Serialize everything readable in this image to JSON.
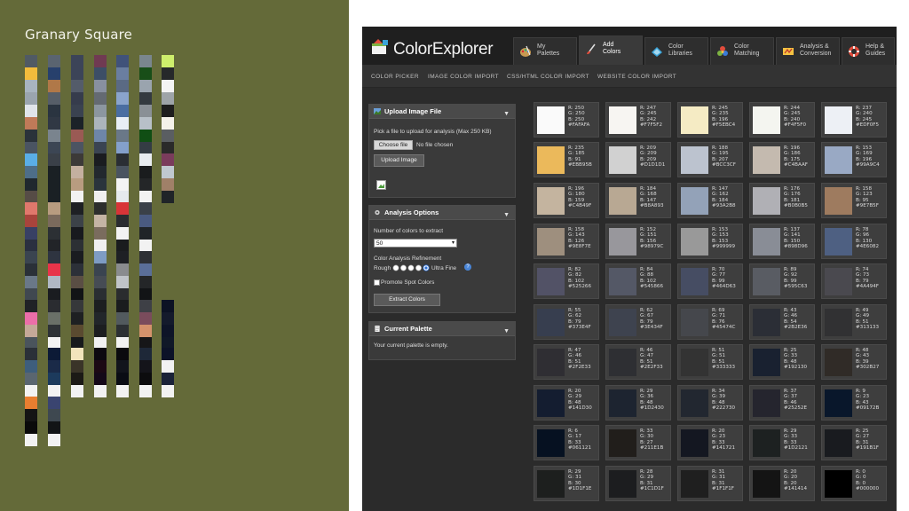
{
  "left": {
    "title": "Granary Square",
    "palettes": [
      {
        "colors": [
          "#505a64",
          "#f2bc3c",
          "#a8b4c0",
          "#9aa4ae"
        ]
      },
      {
        "colors": [
          "#5a6470",
          "#27406c",
          "#b07848",
          "#565e68"
        ]
      },
      {
        "colors": [
          "#3c4458",
          "#3c4458",
          "#545c6a",
          "#363c4c"
        ]
      },
      {
        "colors": [
          "#703a52",
          "#3c4e66",
          "#8890a0",
          "#646a72"
        ]
      },
      {
        "colors": [
          "#40527a",
          "#6a7ea0",
          "#5a6a84",
          "#8aa4cc"
        ]
      },
      {
        "colors": [
          "#7a868e",
          "#184e18",
          "#9aa4ae",
          "#343a40"
        ]
      },
      {
        "colors": [
          "#ceee6c",
          "#26282a",
          "#f4f4f4",
          "#9ea4a8"
        ]
      },
      {
        "colors": [
          "#e0e4ea",
          "#c07a58",
          "#2a323a",
          "#4a5462"
        ]
      },
      {
        "colors": [
          "#2a3440",
          "#303844",
          "#7a848e",
          "#3c4654"
        ]
      },
      {
        "colors": [
          "#3a4250",
          "#1c2228",
          "#9a5a54",
          "#4c5462"
        ]
      },
      {
        "colors": [
          "#8c96a0",
          "#acb4bc",
          "#6e86a8",
          "#3a4452"
        ]
      },
      {
        "colors": [
          "#4a6ea2",
          "#e8eef6",
          "#6a7888",
          "#84a0cc"
        ]
      },
      {
        "colors": [
          "#8a9096",
          "#b8c0c8",
          "#104e14",
          "#343c44"
        ]
      },
      {
        "colors": [
          "#1e1e1e",
          "#f4f2ea",
          "#5a5e62",
          "#2a2a2a"
        ]
      },
      {
        "colors": [
          "#5aaee6",
          "#4e6e88",
          "#20282e",
          "#564c46"
        ]
      },
      {
        "colors": [
          "#3a4048",
          "#1a2024",
          "#1a2024",
          "#1a2024"
        ]
      },
      {
        "colors": [
          "#3c3a38",
          "#c4b0a0",
          "#b89c80",
          "#f2f2f2"
        ]
      },
      {
        "colors": [
          "#1a1c20",
          "#22282e",
          "#2a343c",
          "#f0f0f0"
        ]
      },
      {
        "colors": [
          "#2a2e34",
          "#4a5460",
          "#f4f4f4",
          "#e6eaee"
        ]
      },
      {
        "colors": [
          "#e8ecf0",
          "#1a1c1e",
          "#242628",
          "#f2f2f2"
        ]
      },
      {
        "colors": [
          "#7a3c5c",
          "#c0c8d0",
          "#a08068",
          "#202428"
        ]
      },
      {
        "colors": [
          "#e0786c",
          "#a8443c",
          "#384064",
          "#2a3040"
        ]
      },
      {
        "colors": [
          "#b89c80",
          "#7a6a5c",
          "#2c3034",
          "#222428"
        ]
      },
      {
        "colors": [
          "#1e2024",
          "#3c4248",
          "#181a1e",
          "#2c3034"
        ]
      },
      {
        "colors": [
          "#2c2e2c",
          "#c4b4a4",
          "#7a6c5e",
          "#f0f0f0"
        ]
      },
      {
        "colors": [
          "#d83438",
          "#2a2c30",
          "#f2f2f2",
          "#1a1c1e"
        ]
      },
      {
        "colors": [
          "#3a4048",
          "#4a5a80",
          "#202428",
          "#f2f2f2"
        ]
      },
      {
        "colors": [
          "#3a4450",
          "#2a3038",
          "#6a7888",
          "#404850"
        ]
      },
      {
        "colors": [
          "#2e3440",
          "#e8344a",
          "#b0b8c4",
          "#1a1c20"
        ]
      },
      {
        "colors": [
          "#1a1c20",
          "#2c3038",
          "#5a4e44",
          "#121416"
        ]
      },
      {
        "colors": [
          "#7e9cc4",
          "#3a4450",
          "#464c54",
          "#2a2e32"
        ]
      },
      {
        "colors": [
          "#1e2024",
          "#8a8c8e",
          "#c0c4c8",
          "#2a2c2e"
        ]
      },
      {
        "colors": [
          "#2e3034",
          "#5a6e98",
          "#242628",
          "#121416"
        ]
      },
      {
        "colors": [
          "#202226",
          "#ec6ea8",
          "#c4a898",
          "#4a545c"
        ]
      },
      {
        "colors": [
          "#2a2c30",
          "#6a7068",
          "#2e3236",
          "#f2f2f2"
        ]
      },
      {
        "colors": [
          "#36383a",
          "#1e2022",
          "#5a4a30",
          "#181a1c"
        ]
      },
      {
        "colors": [
          "#1c1e20",
          "#22262a",
          "#1c1e20",
          "#f2f2f2"
        ]
      },
      {
        "colors": [
          "#1a1c1e",
          "#525a5e",
          "#2c3034",
          "#f2f2f2"
        ]
      },
      {
        "colors": [
          "#3e4046",
          "#7a4c5c",
          "#d4926c",
          "#161618"
        ]
      },
      {
        "colors": [
          "#0c1224",
          "#141a2c",
          "#0e1428",
          "#101828"
        ]
      },
      {
        "colors": [
          "#2a3038",
          "#3e5e7c",
          "#5a6670",
          "#f2f2f2"
        ]
      },
      {
        "colors": [
          "#0c1a36",
          "#1a2a48",
          "#1c3a5c",
          "#f2f2f2"
        ]
      },
      {
        "colors": [
          "#f2e4bc",
          "#3a3428",
          "#1c1a16",
          "#f2f2f2"
        ]
      },
      {
        "colors": [
          "#0c0810",
          "#1c0814",
          "#140818",
          "#f2f2f2"
        ]
      },
      {
        "colors": [
          "#0a0a0e",
          "#12141c",
          "#0a0c14",
          "#f2f2f2"
        ]
      },
      {
        "colors": [
          "#1e2838",
          "#14141a",
          "#0c0c0e",
          "#f2f2f2"
        ]
      },
      {
        "colors": [
          "#0c1228",
          "#f2f2f2",
          "#1a2238",
          "#f2f2f2"
        ]
      },
      {
        "colors": [
          "#e87e30",
          "#141414",
          "#0a0a0a",
          "#f2f2f2"
        ]
      },
      {
        "colors": [
          "#3a4470",
          "#3e4850",
          "#121416",
          "#f2f2f2"
        ]
      }
    ]
  },
  "app": {
    "title_part1": "Color",
    "title_part2": "Explorer",
    "tabs": [
      {
        "line1": "My",
        "line2": "Palettes",
        "icon": "palette-icon"
      },
      {
        "line1": "Add",
        "line2": "Colors",
        "icon": "brush-icon"
      },
      {
        "line1": "Color",
        "line2": "Libraries",
        "icon": "library-icon"
      },
      {
        "line1": "Color",
        "line2": "Matching",
        "icon": "color-wheel-icon"
      },
      {
        "line1": "Analysis &",
        "line2": "Conversion",
        "icon": "analysis-icon"
      },
      {
        "line1": "Help &",
        "line2": "Guides",
        "icon": "lifebuoy-icon"
      }
    ],
    "active_tab": "Add Colors",
    "subnav": [
      "COLOR PICKER",
      "IMAGE COLOR IMPORT",
      "CSS/HTML COLOR IMPORT",
      "WEBSITE COLOR IMPORT"
    ],
    "upload": {
      "title": "Upload Image File",
      "description": "Pick a file to upload for analysis (Max 250 KB)",
      "choose_file": "Choose file",
      "no_file": "No file chosen",
      "upload_button": "Upload Image"
    },
    "options": {
      "title": "Analysis Options",
      "num_label": "Number of colors to extract",
      "num_value": "50",
      "refine_label": "Color Analysis Refinement",
      "rough": "Rough",
      "fine": "Ultra Fine",
      "help": "?",
      "promote": "Promote Spot Colors",
      "extract_button": "Extract Colors"
    },
    "current": {
      "title": "Current Palette",
      "empty": "Your current palette is empty."
    },
    "swatches": [
      {
        "r": "R: 250",
        "g": "G: 250",
        "b": "B: 250",
        "hex": "#FAFAFA",
        "color": "#FAFAFA"
      },
      {
        "r": "R: 247",
        "g": "G: 245",
        "b": "B: 242",
        "hex": "#F7F5F2",
        "color": "#F7F5F2"
      },
      {
        "r": "R: 245",
        "g": "G: 235",
        "b": "B: 196",
        "hex": "#F5EBC4",
        "color": "#F5EBC4"
      },
      {
        "r": "R: 244",
        "g": "G: 245",
        "b": "B: 240",
        "hex": "#F4F5F0",
        "color": "#F4F5F0"
      },
      {
        "r": "R: 237",
        "g": "G: 240",
        "b": "B: 245",
        "hex": "#EDF0F5",
        "color": "#EDF0F5"
      },
      {
        "r": "R: 235",
        "g": "G: 185",
        "b": "B: 91",
        "hex": "#EBB95B",
        "color": "#EBB95B"
      },
      {
        "r": "R: 209",
        "g": "G: 209",
        "b": "B: 209",
        "hex": "#D1D1D1",
        "color": "#D1D1D1"
      },
      {
        "r": "R: 188",
        "g": "G: 195",
        "b": "B: 207",
        "hex": "#BCC3CF",
        "color": "#BCC3CF"
      },
      {
        "r": "R: 196",
        "g": "G: 186",
        "b": "B: 175",
        "hex": "#C4BAAF",
        "color": "#C4BAAF"
      },
      {
        "r": "R: 153",
        "g": "G: 169",
        "b": "B: 196",
        "hex": "#99A9C4",
        "color": "#99A9C4"
      },
      {
        "r": "R: 196",
        "g": "G: 180",
        "b": "B: 159",
        "hex": "#C4B49F",
        "color": "#C4B49F"
      },
      {
        "r": "R: 184",
        "g": "G: 168",
        "b": "B: 147",
        "hex": "#B8A893",
        "color": "#B8A893"
      },
      {
        "r": "R: 147",
        "g": "G: 162",
        "b": "B: 184",
        "hex": "#93A2B8",
        "color": "#93A2B8"
      },
      {
        "r": "R: 176",
        "g": "G: 176",
        "b": "B: 181",
        "hex": "#B0B0B5",
        "color": "#B0B0B5"
      },
      {
        "r": "R: 158",
        "g": "G: 123",
        "b": "B: 95",
        "hex": "#9E7B5F",
        "color": "#9E7B5F"
      },
      {
        "r": "R: 158",
        "g": "G: 143",
        "b": "B: 126",
        "hex": "#9E8F7E",
        "color": "#9E8F7E"
      },
      {
        "r": "R: 152",
        "g": "G: 151",
        "b": "B: 156",
        "hex": "#98979C",
        "color": "#98979C"
      },
      {
        "r": "R: 153",
        "g": "G: 153",
        "b": "B: 153",
        "hex": "#999999",
        "color": "#999999"
      },
      {
        "r": "R: 137",
        "g": "G: 141",
        "b": "B: 150",
        "hex": "#898D96",
        "color": "#898D96"
      },
      {
        "r": "R: 78",
        "g": "G: 96",
        "b": "B: 130",
        "hex": "#4E6082",
        "color": "#4E6082"
      },
      {
        "r": "R: 82",
        "g": "G: 82",
        "b": "B: 102",
        "hex": "#525266",
        "color": "#525266"
      },
      {
        "r": "R: 84",
        "g": "G: 88",
        "b": "B: 102",
        "hex": "#545866",
        "color": "#545866"
      },
      {
        "r": "R: 70",
        "g": "G: 77",
        "b": "B: 99",
        "hex": "#464D63",
        "color": "#464D63"
      },
      {
        "r": "R: 89",
        "g": "G: 92",
        "b": "B: 99",
        "hex": "#595C63",
        "color": "#595C63"
      },
      {
        "r": "R: 74",
        "g": "G: 73",
        "b": "B: 79",
        "hex": "#4A494F",
        "color": "#4A494F"
      },
      {
        "r": "R: 55",
        "g": "G: 62",
        "b": "B: 79",
        "hex": "#373E4F",
        "color": "#373E4F"
      },
      {
        "r": "R: 62",
        "g": "G: 67",
        "b": "B: 79",
        "hex": "#3E434F",
        "color": "#3E434F"
      },
      {
        "r": "R: 69",
        "g": "G: 71",
        "b": "B: 76",
        "hex": "#45474C",
        "color": "#45474C"
      },
      {
        "r": "R: 43",
        "g": "G: 46",
        "b": "B: 54",
        "hex": "#2B2E36",
        "color": "#2B2E36"
      },
      {
        "r": "R: 49",
        "g": "G: 49",
        "b": "B: 51",
        "hex": "#313133",
        "color": "#313133"
      },
      {
        "r": "R: 47",
        "g": "G: 46",
        "b": "B: 51",
        "hex": "#2F2E33",
        "color": "#2F2E33"
      },
      {
        "r": "R: 46",
        "g": "G: 47",
        "b": "B: 51",
        "hex": "#2E2F33",
        "color": "#2E2F33"
      },
      {
        "r": "R: 51",
        "g": "G: 51",
        "b": "B: 51",
        "hex": "#333333",
        "color": "#333333"
      },
      {
        "r": "R: 25",
        "g": "G: 33",
        "b": "B: 48",
        "hex": "#192130",
        "color": "#192130"
      },
      {
        "r": "R: 48",
        "g": "G: 43",
        "b": "B: 39",
        "hex": "#302B27",
        "color": "#302B27"
      },
      {
        "r": "R: 20",
        "g": "G: 29",
        "b": "B: 48",
        "hex": "#141D30",
        "color": "#141D30"
      },
      {
        "r": "R: 29",
        "g": "G: 36",
        "b": "B: 48",
        "hex": "#1D2430",
        "color": "#1D2430"
      },
      {
        "r": "R: 34",
        "g": "G: 39",
        "b": "B: 48",
        "hex": "#222730",
        "color": "#222730"
      },
      {
        "r": "R: 37",
        "g": "G: 37",
        "b": "B: 46",
        "hex": "#25252E",
        "color": "#25252E"
      },
      {
        "r": "R: 9",
        "g": "G: 23",
        "b": "B: 43",
        "hex": "#09172B",
        "color": "#09172B"
      },
      {
        "r": "R: 6",
        "g": "G: 17",
        "b": "B: 33",
        "hex": "#061121",
        "color": "#061121"
      },
      {
        "r": "R: 33",
        "g": "G: 30",
        "b": "B: 27",
        "hex": "#211E1B",
        "color": "#211E1B"
      },
      {
        "r": "R: 20",
        "g": "G: 23",
        "b": "B: 33",
        "hex": "#141721",
        "color": "#141721"
      },
      {
        "r": "R: 29",
        "g": "G: 33",
        "b": "B: 33",
        "hex": "#1D2121",
        "color": "#1D2121"
      },
      {
        "r": "R: 25",
        "g": "G: 27",
        "b": "B: 31",
        "hex": "#191B1F",
        "color": "#191B1F"
      },
      {
        "r": "R: 29",
        "g": "G: 31",
        "b": "B: 30",
        "hex": "#1D1F1E",
        "color": "#1D1F1E"
      },
      {
        "r": "R: 28",
        "g": "G: 29",
        "b": "B: 31",
        "hex": "#1C1D1F",
        "color": "#1C1D1F"
      },
      {
        "r": "R: 31",
        "g": "G: 31",
        "b": "B: 31",
        "hex": "#1F1F1F",
        "color": "#1F1F1F"
      },
      {
        "r": "R: 20",
        "g": "G: 20",
        "b": "B: 20",
        "hex": "#141414",
        "color": "#141414"
      },
      {
        "r": "R: 0",
        "g": "G: 0",
        "b": "B: 0",
        "hex": "#000000",
        "color": "#000000"
      }
    ]
  }
}
